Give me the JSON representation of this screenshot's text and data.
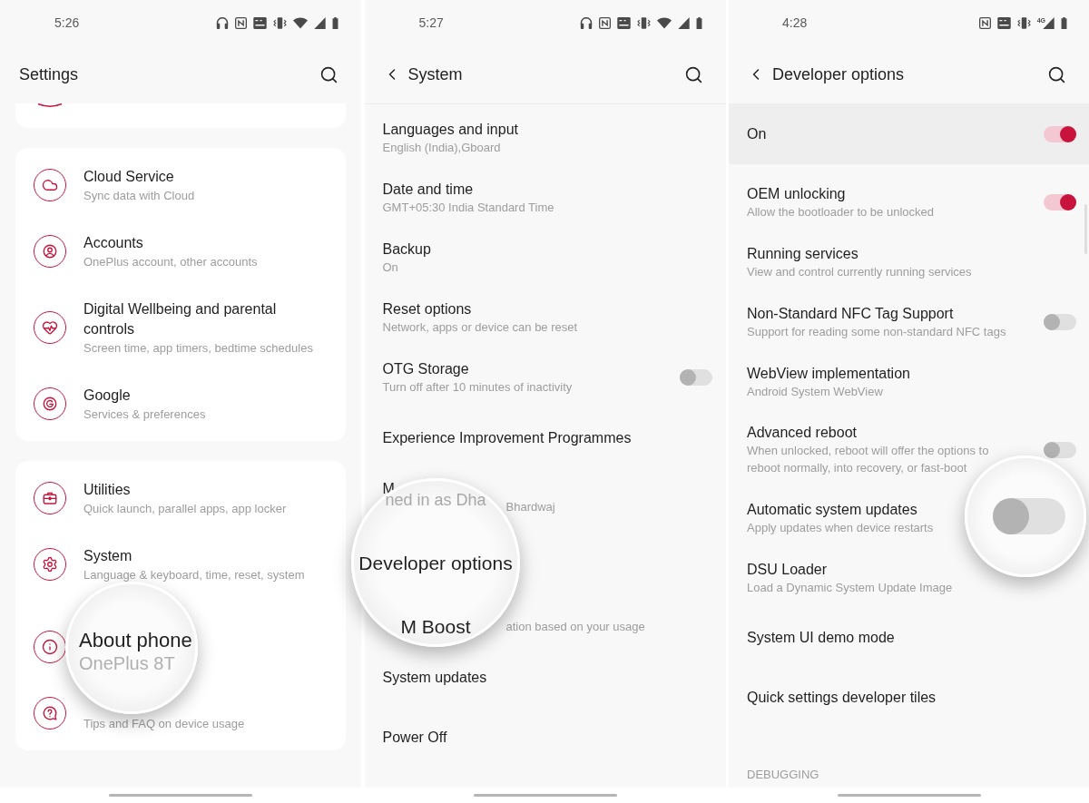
{
  "settings_screen": {
    "status_bar": {
      "time": "5:26"
    },
    "title": "Settings",
    "groups": [
      {
        "items": [
          {
            "kind": "entry",
            "title": "Cloud Service",
            "subtitle": "Sync data with Cloud"
          },
          {
            "kind": "entry",
            "title": "Accounts",
            "subtitle": "OnePlus account, other accounts"
          },
          {
            "kind": "entry",
            "title": "Digital Wellbeing and parental controls",
            "subtitle": "Screen time, app timers, bedtime schedules"
          },
          {
            "kind": "entry",
            "title": "Google",
            "subtitle": "Services & preferences"
          }
        ]
      },
      {
        "items": [
          {
            "kind": "entry",
            "title": "Utilities",
            "subtitle": "Quick launch, parallel apps, app locker"
          },
          {
            "kind": "entry",
            "title": "System",
            "subtitle": "Language & keyboard, time, reset, system"
          },
          {
            "kind": "covered"
          },
          {
            "kind": "entry",
            "subtitle": "Tips and FAQ on device usage"
          }
        ]
      }
    ],
    "magnifier": {
      "title": "About phone",
      "subtitle": "OnePlus 8T"
    }
  },
  "system_screen": {
    "status_bar": {
      "time": "5:27"
    },
    "title": "System",
    "items": [
      {
        "kind": "entry",
        "title": "Languages and input",
        "subtitle": "English (India),Gboard"
      },
      {
        "kind": "entry",
        "title": "Date and time",
        "subtitle": "GMT+05:30 India Standard Time"
      },
      {
        "kind": "entry",
        "title": "Backup",
        "subtitle": "On"
      },
      {
        "kind": "entry",
        "title": "Reset options",
        "subtitle": "Network, apps or device can be reset"
      },
      {
        "kind": "switch",
        "title": "OTG Storage",
        "subtitle": "Turn off after 10 minutes of inactivity",
        "on": false
      },
      {
        "kind": "entry",
        "title": "Experience Improvement Programmes"
      },
      {
        "kind": "covered",
        "title": "M",
        "subtitle": "Bhardwaj"
      },
      {
        "kind": "covered"
      },
      {
        "kind": "covered",
        "subtitle": "ation based on your usage"
      },
      {
        "kind": "entry",
        "title": "System updates"
      },
      {
        "kind": "entry",
        "title": "Power Off"
      }
    ],
    "magnifier": {
      "lines": [
        {
          "kind": "subtitle",
          "text": "ned in as Dha"
        },
        {
          "kind": "title",
          "text": "Developer options"
        },
        {
          "kind": "title",
          "text": "M Boost"
        }
      ]
    }
  },
  "developer_options_screen": {
    "status_bar": {
      "time": "4:28",
      "network_type": "4G"
    },
    "title": "Developer options",
    "master_switch": {
      "label": "On",
      "on": true
    },
    "items": [
      {
        "kind": "switch",
        "title": "OEM unlocking",
        "subtitle": "Allow the bootloader to be unlocked",
        "on": true
      },
      {
        "kind": "entry",
        "title": "Running services",
        "subtitle": "View and control currently running services"
      },
      {
        "kind": "switch",
        "title": "Non-Standard NFC Tag Support",
        "subtitle": "Support for reading some non-standard NFC tags",
        "on": false
      },
      {
        "kind": "entry",
        "title": "WebView implementation",
        "subtitle": "Android System WebView"
      },
      {
        "kind": "switch",
        "title": "Advanced reboot",
        "subtitle": "When unlocked, reboot will offer the options to reboot normally, into recovery, or fast-boot",
        "on": false
      },
      {
        "kind": "entry",
        "title": "Automatic system updates",
        "subtitle": "Apply updates when device restarts"
      },
      {
        "kind": "entry",
        "title": "DSU Loader",
        "subtitle": "Load a Dynamic System Update Image"
      },
      {
        "kind": "entry",
        "title": "System UI demo mode"
      },
      {
        "kind": "entry",
        "title": "Quick settings developer tiles"
      }
    ],
    "section_header": "DEBUGGING",
    "magnifier": {
      "on": false
    }
  }
}
